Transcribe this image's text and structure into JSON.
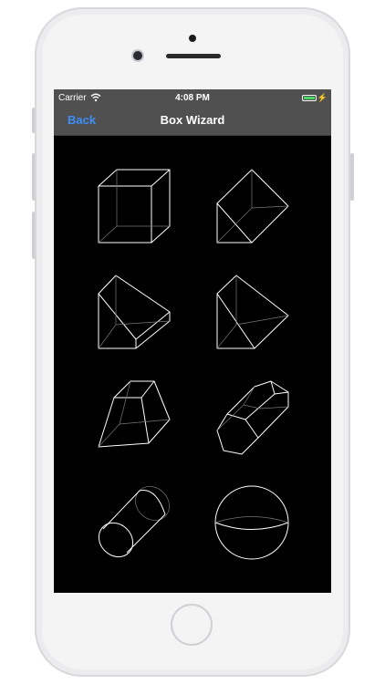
{
  "status_bar": {
    "carrier": "Carrier",
    "time": "4:08 PM",
    "bolt": "⚡"
  },
  "nav": {
    "back_label": "Back",
    "title": "Box Wizard"
  },
  "shapes": [
    {
      "name": "cube"
    },
    {
      "name": "triangular-prism"
    },
    {
      "name": "wedge"
    },
    {
      "name": "sloped-wedge"
    },
    {
      "name": "truncated-pyramid"
    },
    {
      "name": "hexagonal-prism"
    },
    {
      "name": "cylinder"
    },
    {
      "name": "sphere"
    }
  ]
}
